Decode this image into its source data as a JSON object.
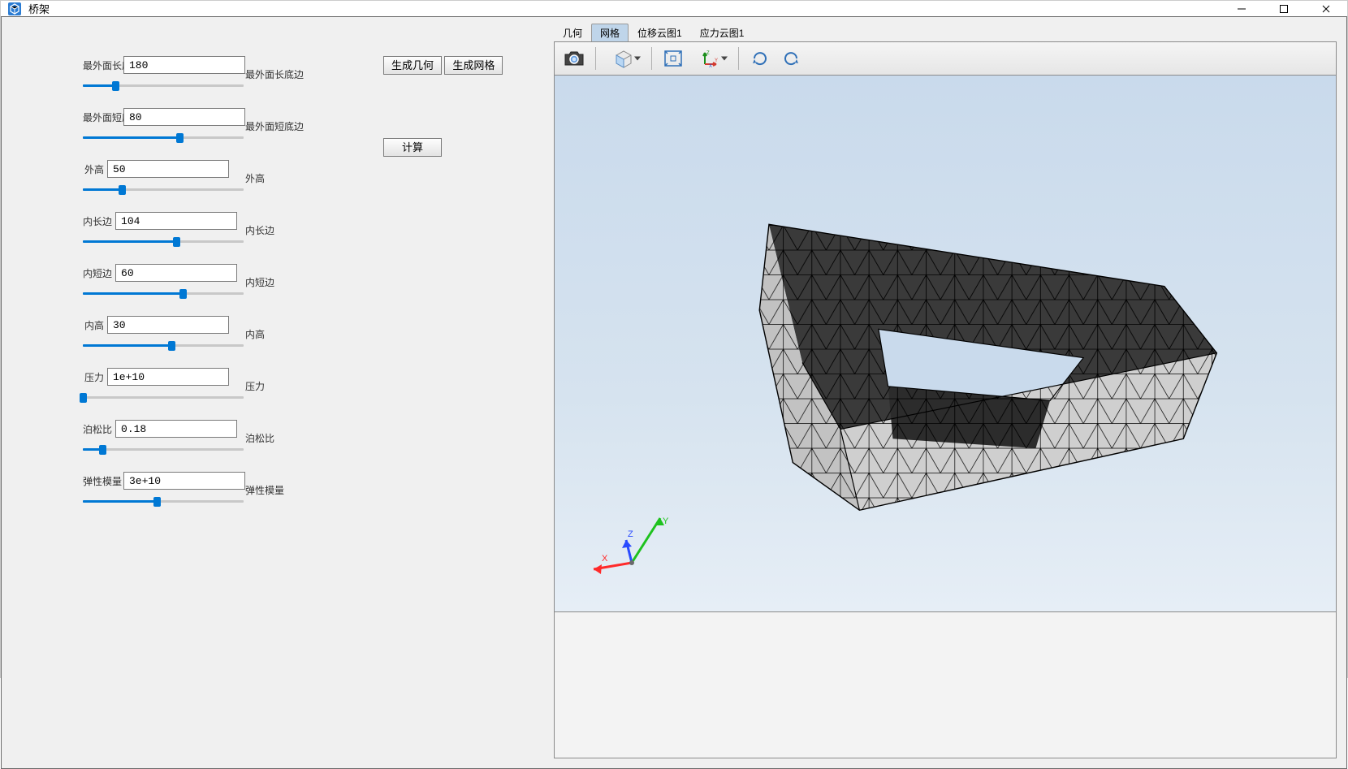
{
  "window": {
    "title": "桥架"
  },
  "params": [
    {
      "label": "最外面长底边",
      "value": "180",
      "fill_pct": 20,
      "label_narrow": false
    },
    {
      "label": "最外面短底边",
      "value": "80",
      "fill_pct": 60,
      "label_narrow": false
    },
    {
      "label": "外高",
      "value": "50",
      "fill_pct": 24,
      "label_narrow": true
    },
    {
      "label": "内长边",
      "value": "104",
      "fill_pct": 58,
      "label_narrow": true
    },
    {
      "label": "内短边",
      "value": "60",
      "fill_pct": 62,
      "label_narrow": true
    },
    {
      "label": "内高",
      "value": "30",
      "fill_pct": 55,
      "label_narrow": true
    },
    {
      "label": "压力",
      "value": "1e+10",
      "fill_pct": 0,
      "label_narrow": true
    },
    {
      "label": "泊松比",
      "value": "0.18",
      "fill_pct": 12,
      "label_narrow": true
    },
    {
      "label": "弹性模量",
      "value": "3e+10",
      "fill_pct": 46,
      "label_narrow": true
    }
  ],
  "echo_labels": [
    "最外面长底边",
    "最外面短底边",
    "外高",
    "内长边",
    "内短边",
    "内高",
    "压力",
    "泊松比",
    "弹性模量"
  ],
  "actions": {
    "generate_geometry": "生成几何",
    "generate_mesh": "生成网格",
    "compute": "计算"
  },
  "tabs": [
    {
      "label": "几何",
      "active": false
    },
    {
      "label": "网格",
      "active": true
    },
    {
      "label": "位移云图1",
      "active": false
    },
    {
      "label": "应力云图1",
      "active": false
    }
  ],
  "toolbar": {
    "screenshot": "screenshot-icon",
    "view_cube": "view-cube-icon",
    "fit": "fit-view-icon",
    "axes": "axes-icon",
    "rotate_cw": "rotate-cw-icon",
    "rotate_ccw": "rotate-ccw-icon"
  },
  "axis_labels": {
    "x": "X",
    "y": "Y",
    "z": "Z"
  }
}
